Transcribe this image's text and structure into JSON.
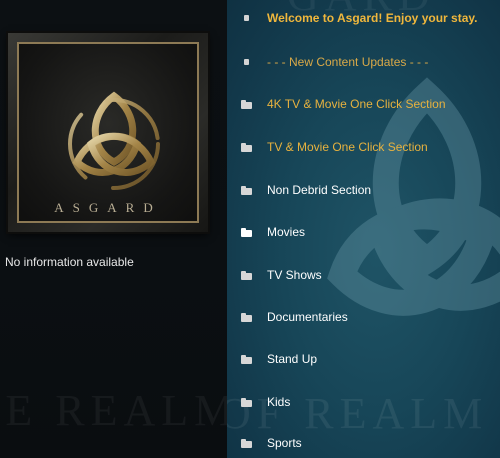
{
  "left_panel": {
    "poster_title": "ASGARD",
    "info_text": "No information available"
  },
  "background": {
    "watermark_text": "OF REALM OF SC"
  },
  "menu": {
    "items": [
      {
        "label": "Welcome to Asgard! Enjoy your stay.",
        "icon": "file-icon"
      },
      {
        "label": "- - - New Content Updates - - -",
        "icon": "file-icon"
      },
      {
        "label": "4K TV & Movie One Click Section",
        "icon": "folder-icon"
      },
      {
        "label": "TV & Movie One Click Section",
        "icon": "folder-icon"
      },
      {
        "label": "Non Debrid Section",
        "icon": "folder-icon"
      },
      {
        "label": "Movies",
        "icon": "folder-icon"
      },
      {
        "label": "TV Shows",
        "icon": "folder-icon"
      },
      {
        "label": "Documentaries",
        "icon": "folder-icon"
      },
      {
        "label": "Stand Up",
        "icon": "folder-icon"
      },
      {
        "label": "Kids",
        "icon": "folder-icon"
      },
      {
        "label": "Sports",
        "icon": "folder-icon"
      }
    ]
  },
  "colors": {
    "accent_gold": "#e7b23f",
    "panel_teal": "#174658",
    "text_white": "#ffffff"
  }
}
